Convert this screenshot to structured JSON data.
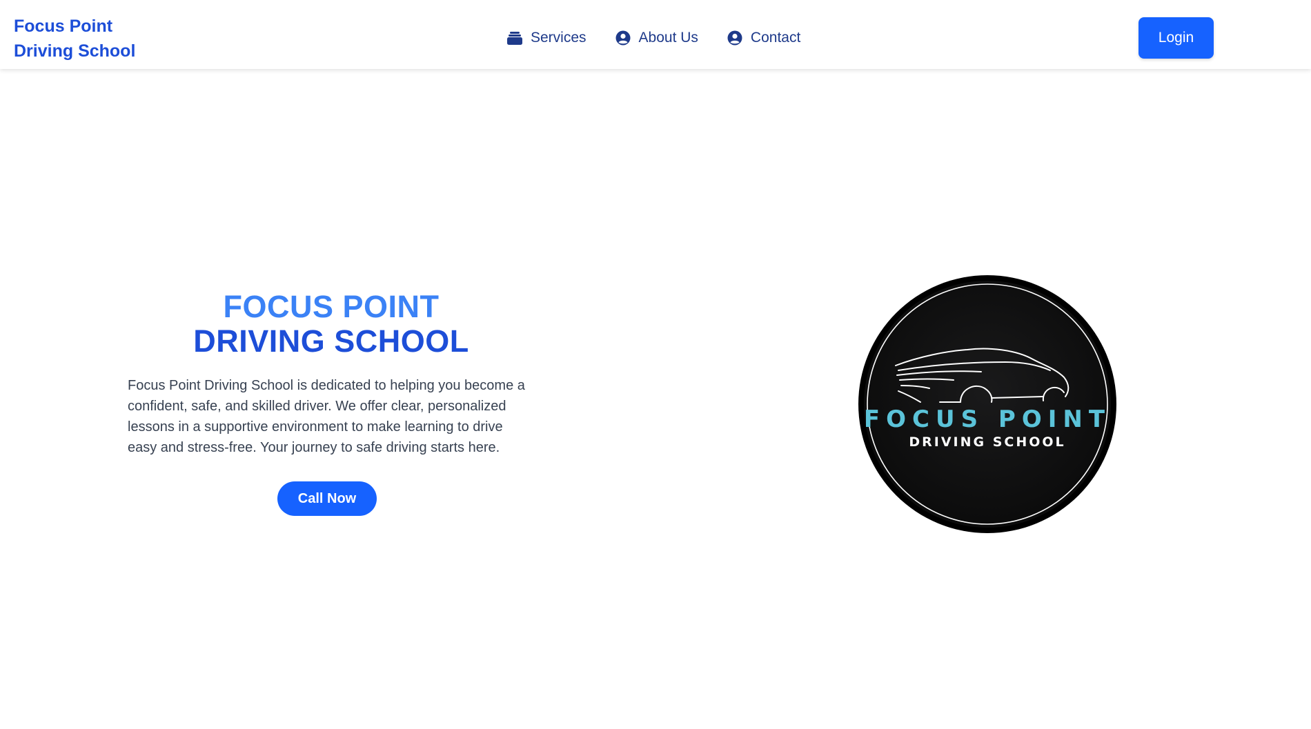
{
  "header": {
    "brand_line1": "Focus Point",
    "brand_line2": "Driving School",
    "nav": [
      {
        "label": "Services",
        "icon": "services-icon"
      },
      {
        "label": "About Us",
        "icon": "user-circle-icon"
      },
      {
        "label": "Contact",
        "icon": "user-circle-icon"
      }
    ],
    "login_label": "Login"
  },
  "hero": {
    "title_line1": "FOCUS POINT",
    "title_line2": "DRIVING SCHOOL",
    "description": "Focus Point Driving School is dedicated to helping you become a confident, safe, and skilled driver. We offer clear, personalized lessons in a supportive environment to make learning to drive easy and stress-free. Your journey to safe driving starts here.",
    "cta_label": "Call Now",
    "logo": {
      "text_line1": "FOCUS POINT",
      "text_line2": "DRIVING SCHOOL"
    }
  },
  "colors": {
    "accent": "#1662ff",
    "brand": "#1d4ed8",
    "title_light": "#3b82f6",
    "nav_text": "#1e3a8a",
    "logo_teal": "#5bc3d9",
    "logo_bg": "#0e0e0f"
  }
}
